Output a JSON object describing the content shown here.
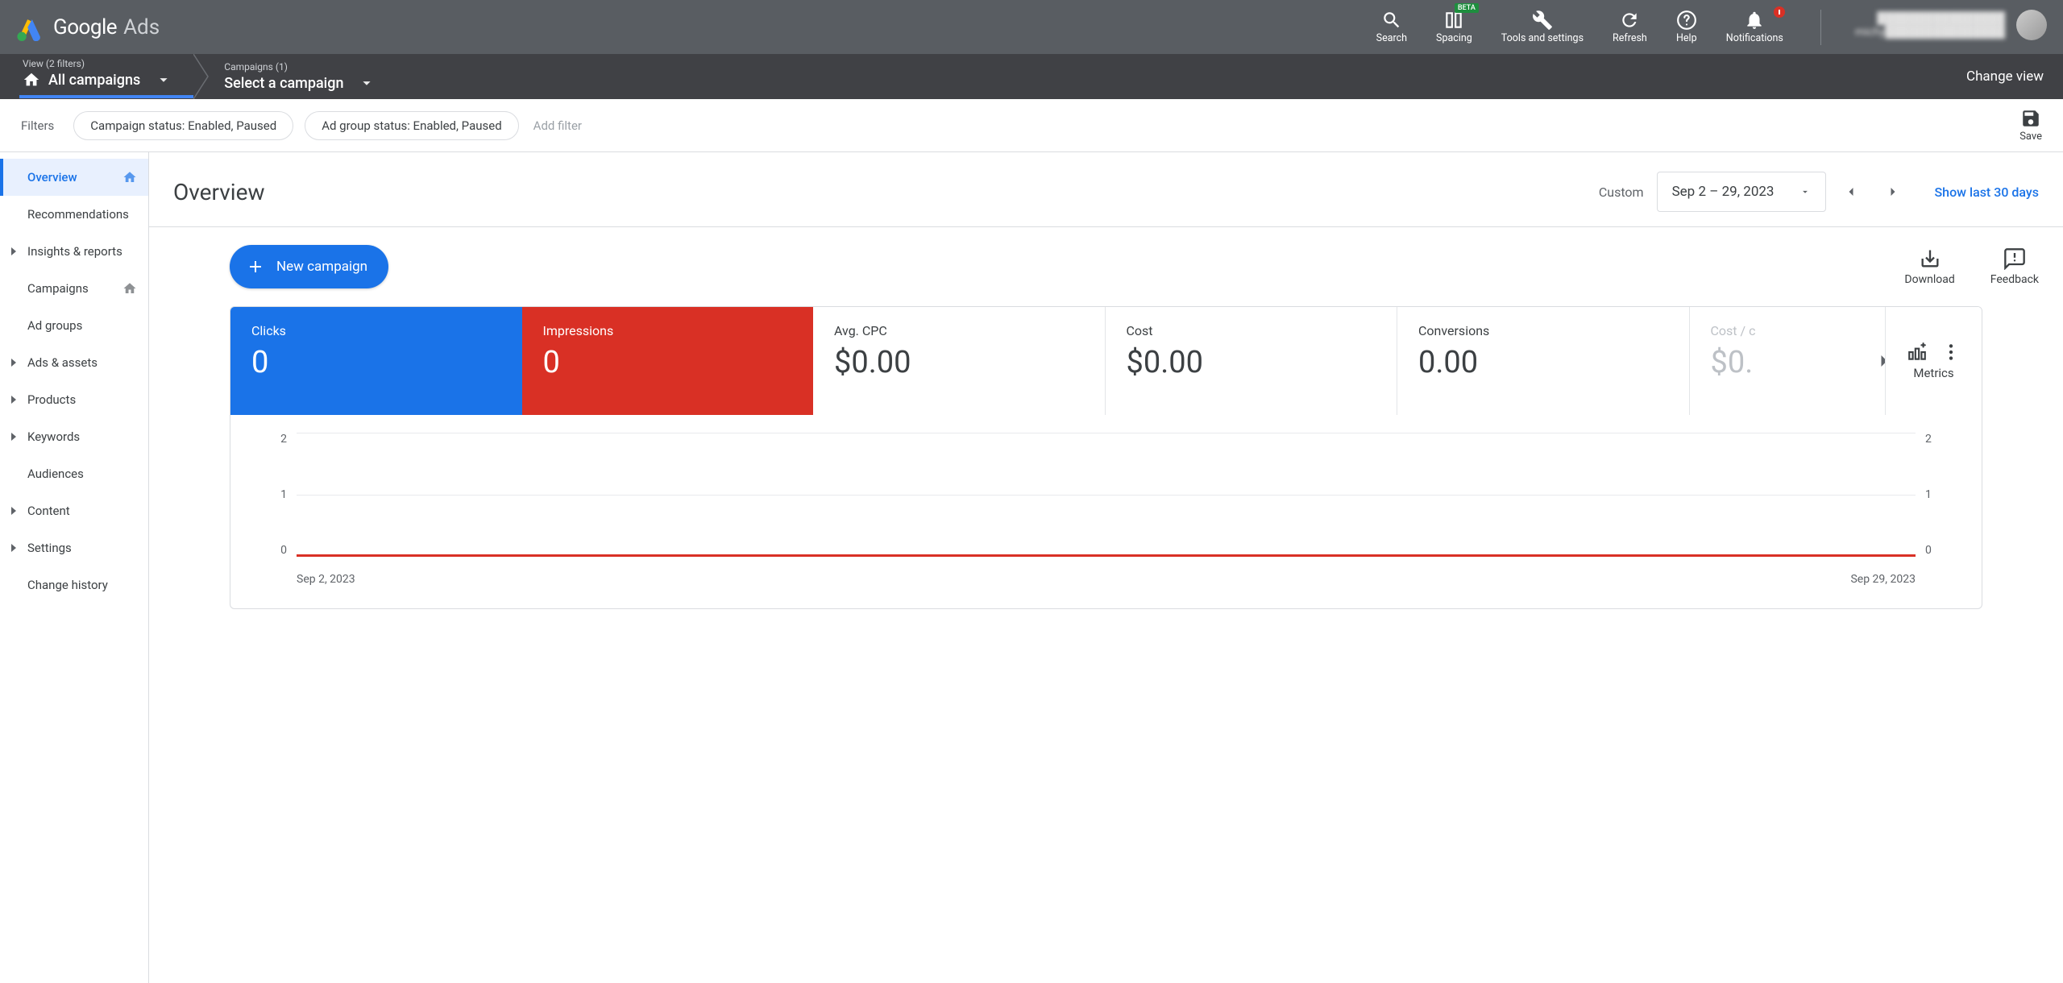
{
  "topbar": {
    "logo_google": "Google",
    "logo_ads": "Ads",
    "tools": {
      "search": "Search",
      "spacing": "Spacing",
      "spacing_badge": "BETA",
      "tools_settings": "Tools and settings",
      "refresh": "Refresh",
      "help": "Help",
      "notifications": "Notifications"
    },
    "account": {
      "line1": "████████████████",
      "line2": "michy███████████████"
    }
  },
  "crumb": {
    "view_label": "View (2 filters)",
    "view_value": "All campaigns",
    "campaigns_label": "Campaigns (1)",
    "campaigns_value": "Select a campaign",
    "change_view": "Change view"
  },
  "filters": {
    "label": "Filters",
    "chip1": "Campaign status: Enabled, Paused",
    "chip2": "Ad group status: Enabled, Paused",
    "add": "Add filter",
    "save": "Save"
  },
  "sidebar": {
    "items": [
      {
        "label": "Overview",
        "active": true,
        "expandable": false,
        "home": true
      },
      {
        "label": "Recommendations",
        "active": false,
        "expandable": false
      },
      {
        "label": "Insights & reports",
        "active": false,
        "expandable": true
      },
      {
        "label": "Campaigns",
        "active": false,
        "expandable": false,
        "home": true
      },
      {
        "label": "Ad groups",
        "active": false,
        "expandable": false
      },
      {
        "label": "Ads & assets",
        "active": false,
        "expandable": true
      },
      {
        "label": "Products",
        "active": false,
        "expandable": true
      },
      {
        "label": "Keywords",
        "active": false,
        "expandable": true
      },
      {
        "label": "Audiences",
        "active": false,
        "expandable": false
      },
      {
        "label": "Content",
        "active": false,
        "expandable": true
      },
      {
        "label": "Settings",
        "active": false,
        "expandable": true
      },
      {
        "label": "Change history",
        "active": false,
        "expandable": false
      }
    ]
  },
  "overview": {
    "title": "Overview",
    "custom": "Custom",
    "date_range": "Sep 2 – 29, 2023",
    "show_last": "Show last 30 days",
    "new_campaign": "New campaign",
    "download": "Download",
    "feedback": "Feedback",
    "metrics_label": "Metrics"
  },
  "metrics": [
    {
      "label": "Clicks",
      "value": "0",
      "style": "blue"
    },
    {
      "label": "Impressions",
      "value": "0",
      "style": "red"
    },
    {
      "label": "Avg. CPC",
      "value": "$0.00",
      "style": "white"
    },
    {
      "label": "Cost",
      "value": "$0.00",
      "style": "white"
    },
    {
      "label": "Conversions",
      "value": "0.00",
      "style": "white"
    },
    {
      "label": "Cost / c",
      "value": "$0.",
      "style": "cut"
    }
  ],
  "chart_data": {
    "type": "line",
    "x": [
      "Sep 2, 2023",
      "Sep 29, 2023"
    ],
    "series": [
      {
        "name": "Clicks",
        "values": [
          0,
          0
        ],
        "color": "#1a73e8"
      },
      {
        "name": "Impressions",
        "values": [
          0,
          0
        ],
        "color": "#d93025"
      }
    ],
    "y_left_ticks": [
      2,
      1,
      0
    ],
    "y_right_ticks": [
      2,
      1,
      0
    ],
    "ylim": [
      0,
      2
    ],
    "xlabel": "",
    "ylabel": ""
  }
}
